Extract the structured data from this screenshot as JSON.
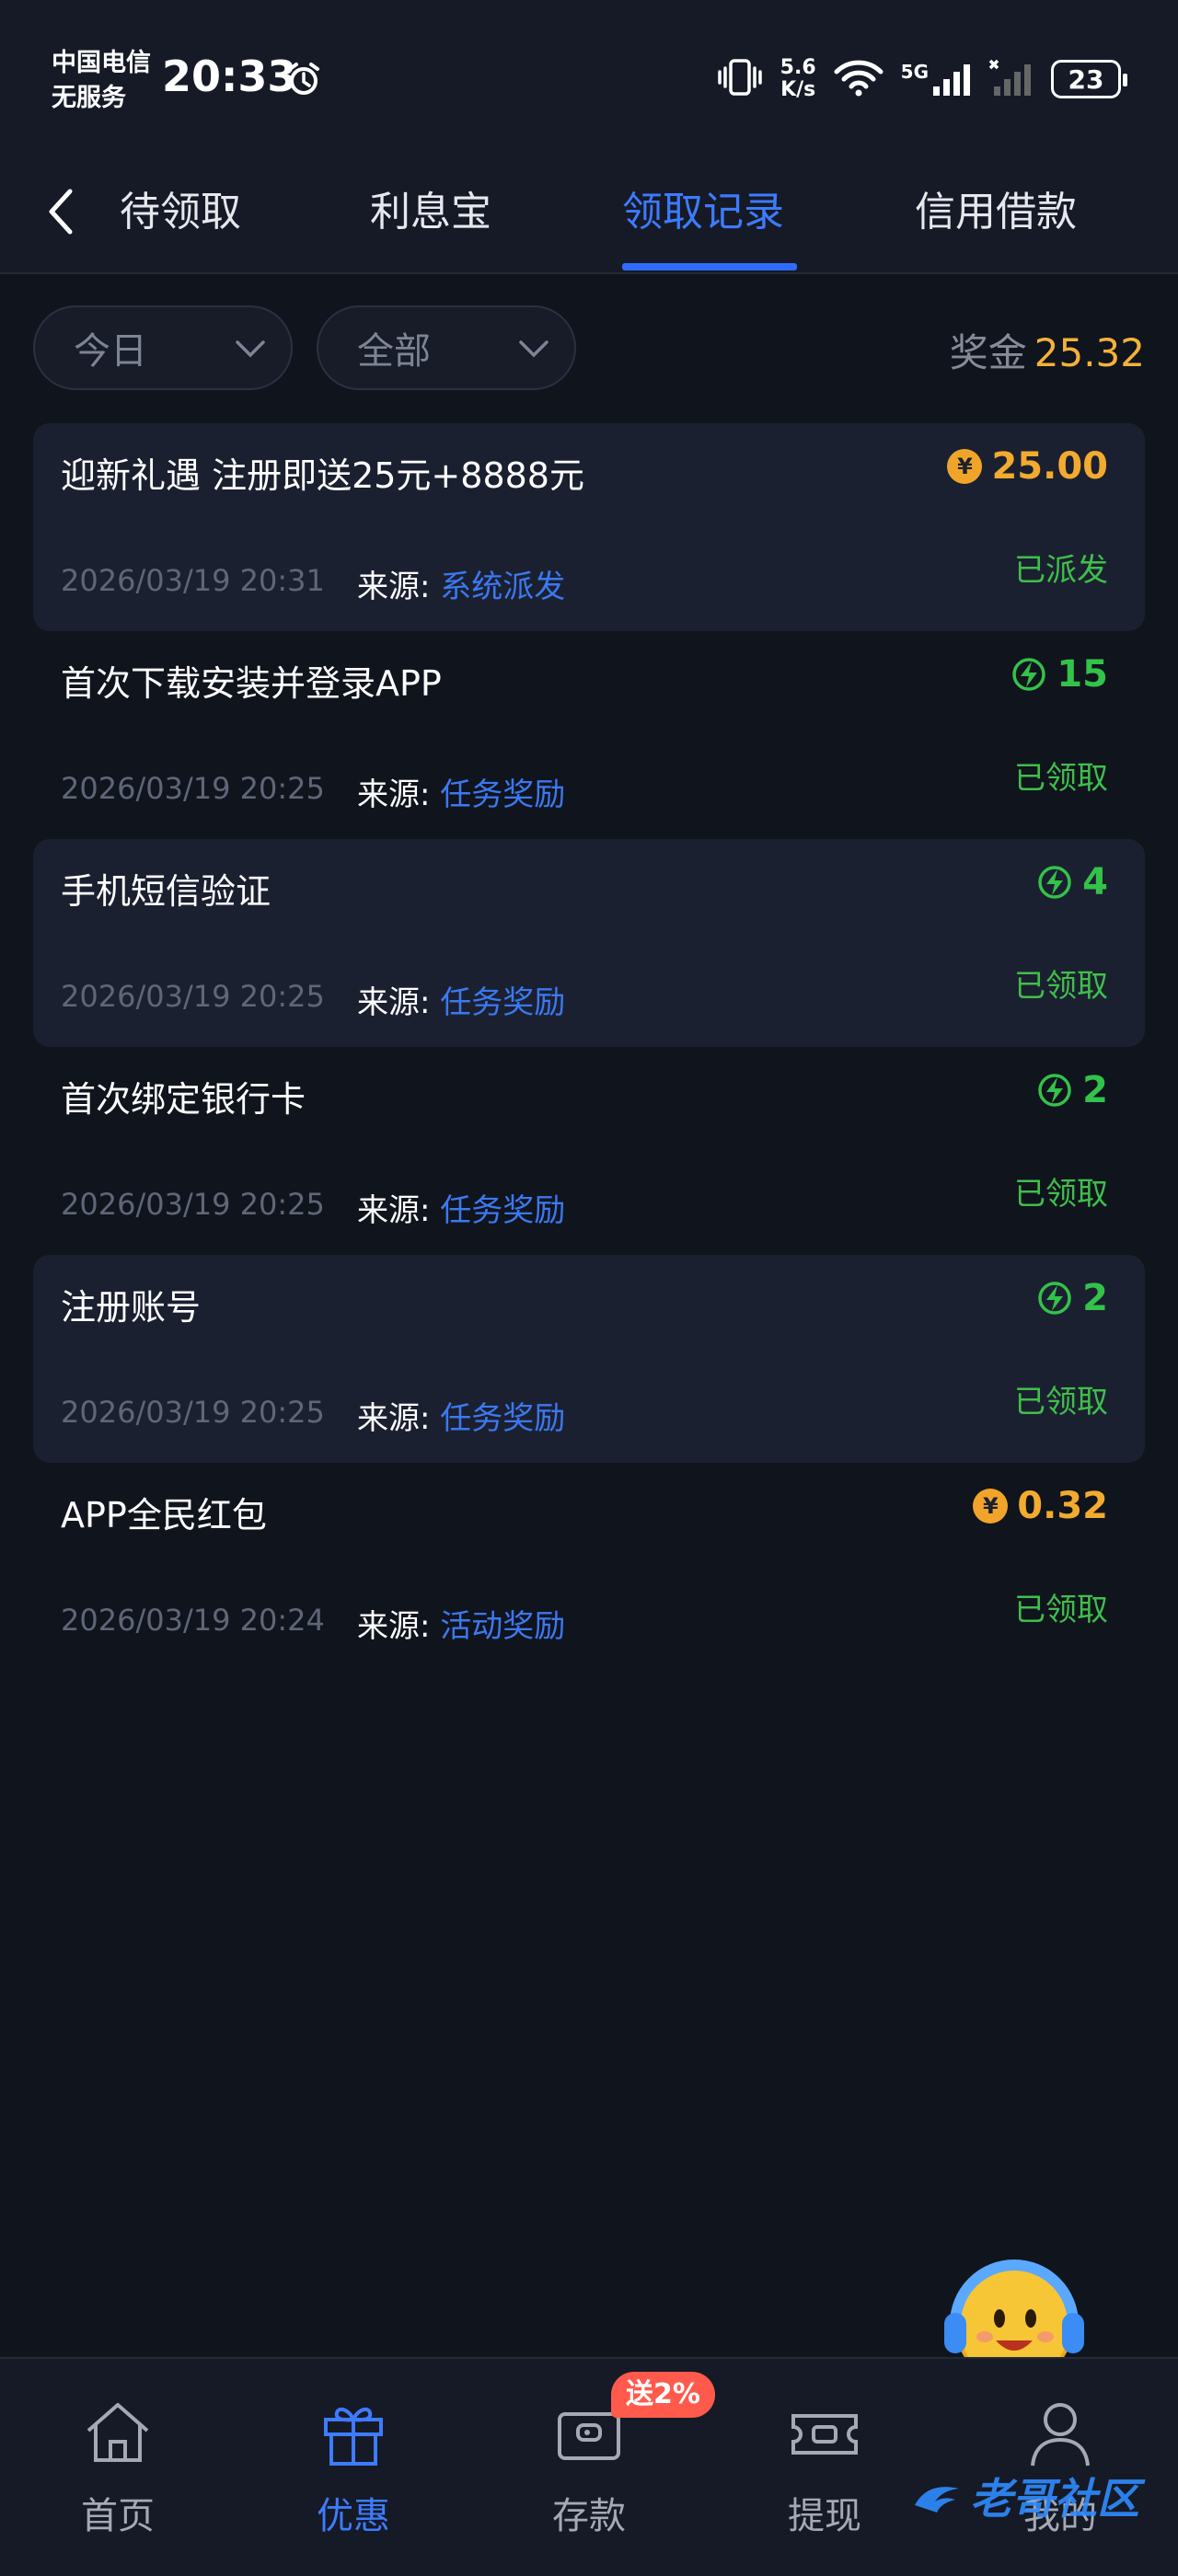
{
  "status_bar": {
    "carrier": "中国电信",
    "service": "无服务",
    "time": "20:33",
    "speed_value": "5.6",
    "speed_unit": "K/s",
    "network": "5G",
    "battery": "23"
  },
  "tabs": [
    {
      "label": "待领取",
      "active": false
    },
    {
      "label": "利息宝",
      "active": false
    },
    {
      "label": "领取记录",
      "active": true
    },
    {
      "label": "信用借款",
      "active": false
    }
  ],
  "filters": {
    "date": "今日",
    "type": "全部",
    "prize_label": "奖金",
    "prize_amount": "25.32"
  },
  "records": [
    {
      "title": "迎新礼遇 注册即送25元+8888元",
      "amount": "25.00",
      "amount_type": "coin",
      "time": "2026/03/19 20:31",
      "source_label": "来源:",
      "source": "系统派发",
      "status": "已派发"
    },
    {
      "title": "首次下载安装并登录APP",
      "amount": "15",
      "amount_type": "energy",
      "time": "2026/03/19 20:25",
      "source_label": "来源:",
      "source": "任务奖励",
      "status": "已领取"
    },
    {
      "title": "手机短信验证",
      "amount": "4",
      "amount_type": "energy",
      "time": "2026/03/19 20:25",
      "source_label": "来源:",
      "source": "任务奖励",
      "status": "已领取"
    },
    {
      "title": "首次绑定银行卡",
      "amount": "2",
      "amount_type": "energy",
      "time": "2026/03/19 20:25",
      "source_label": "来源:",
      "source": "任务奖励",
      "status": "已领取"
    },
    {
      "title": "注册账号",
      "amount": "2",
      "amount_type": "energy",
      "time": "2026/03/19 20:25",
      "source_label": "来源:",
      "source": "任务奖励",
      "status": "已领取"
    },
    {
      "title": "APP全民红包",
      "amount": "0.32",
      "amount_type": "coin",
      "time": "2026/03/19 20:24",
      "source_label": "来源:",
      "source": "活动奖励",
      "status": "已领取"
    }
  ],
  "bottom_nav": [
    {
      "label": "首页",
      "icon": "home-icon",
      "active": false
    },
    {
      "label": "优惠",
      "icon": "gift-icon",
      "active": true
    },
    {
      "label": "存款",
      "icon": "wallet-icon",
      "active": false
    },
    {
      "label": "提现",
      "icon": "withdraw-ticket-icon",
      "active": false
    },
    {
      "label": "我的",
      "icon": "user-icon",
      "active": false
    }
  ],
  "deposit_badge": "送2%",
  "watermark": "老哥社区",
  "colors": {
    "accent": "#3d7bff",
    "gold": "#f2ab2f",
    "green": "#3fbf4a",
    "background": "#10141d"
  }
}
